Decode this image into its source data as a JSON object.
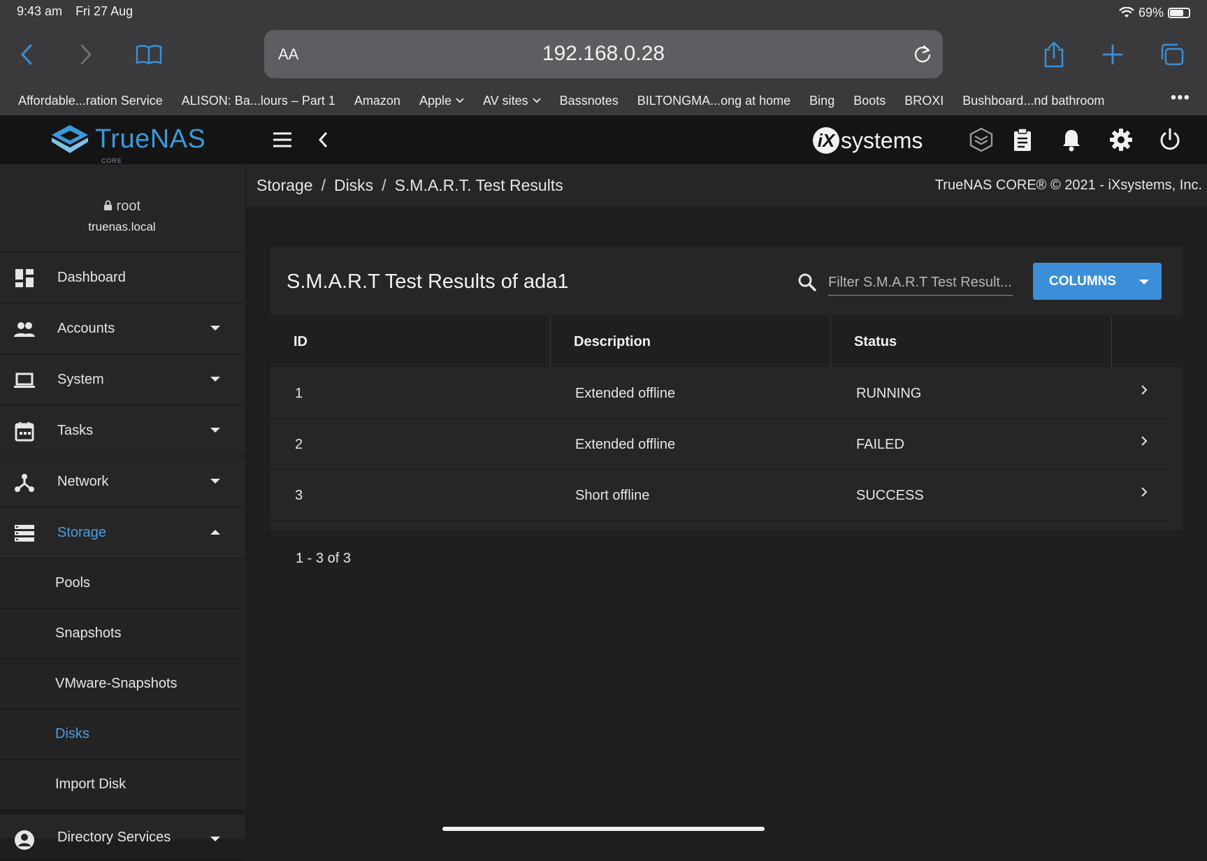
{
  "status_bar": {
    "time": "9:43 am",
    "date": "Fri 27 Aug",
    "battery": "69%"
  },
  "browser": {
    "aa_label": "AA",
    "url": "192.168.0.28",
    "bookmarks": [
      "Affordable...ration Service",
      "ALISON: Ba...lours – Part 1",
      "Amazon",
      "Apple",
      "AV sites",
      "Bassnotes",
      "BILTONGMA...ong at home",
      "Bing",
      "Boots",
      "BROXI",
      "Bushboard...nd bathroom"
    ],
    "more": "•••"
  },
  "app": {
    "logo_name": "TrueNAS",
    "logo_sub": "CORE",
    "vendor": "systems",
    "vendor_mark": "iX"
  },
  "user": {
    "name": "root",
    "host": "truenas.local"
  },
  "sidebar": {
    "items": [
      {
        "label": "Dashboard"
      },
      {
        "label": "Accounts"
      },
      {
        "label": "System"
      },
      {
        "label": "Tasks"
      },
      {
        "label": "Network"
      },
      {
        "label": "Storage"
      }
    ],
    "storage_sub": [
      "Pools",
      "Snapshots",
      "VMware-Snapshots",
      "Disks",
      "Import Disk"
    ],
    "next_item": "Directory Services"
  },
  "breadcrumb": {
    "items": [
      "Storage",
      "Disks",
      "S.M.A.R.T. Test Results"
    ],
    "separator": "/"
  },
  "copyright": "TrueNAS CORE® © 2021 - iXsystems, Inc.",
  "card": {
    "title": "S.M.A.R.T Test Results of ada1",
    "filter_placeholder": "Filter S.M.A.R.T Test Result...",
    "columns_button": "COLUMNS",
    "headers": [
      "ID",
      "Description",
      "Status"
    ],
    "rows": [
      {
        "id": "1",
        "description": "Extended offline",
        "status": "RUNNING"
      },
      {
        "id": "2",
        "description": "Extended offline",
        "status": "FAILED"
      },
      {
        "id": "3",
        "description": "Short offline",
        "status": "SUCCESS"
      }
    ],
    "pager": "1 - 3 of 3"
  },
  "colors": {
    "accent": "#3b8fd8",
    "active_text": "#4a9ee0",
    "logo": "#3a9ad9"
  }
}
